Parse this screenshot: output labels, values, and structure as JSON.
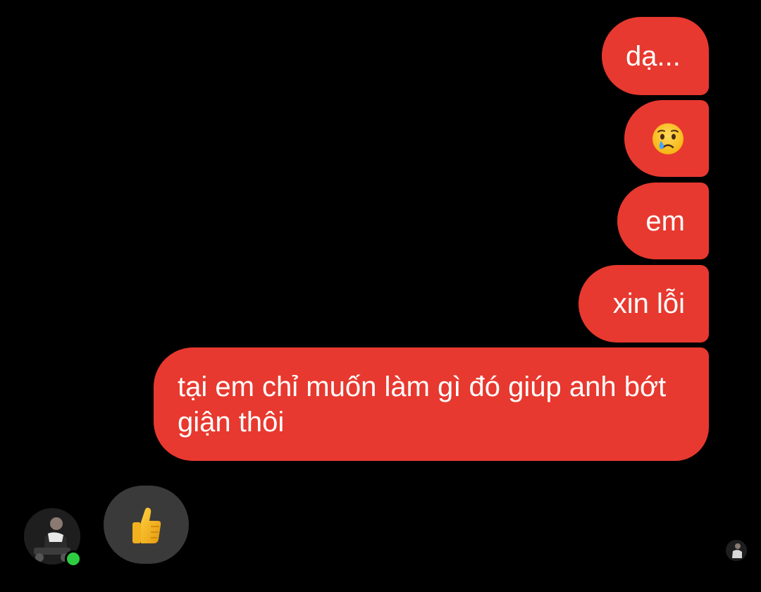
{
  "chat": {
    "messages": [
      {
        "text": "dạ..."
      },
      {
        "emoji": "crying-face"
      },
      {
        "text": "em"
      },
      {
        "text": "xin lỗi"
      },
      {
        "text": "tại em chỉ muốn làm gì đó giúp anh bớt giận thôi"
      }
    ],
    "reaction": {
      "emoji": "thumbs-up"
    },
    "contact": {
      "online": true
    }
  },
  "colors": {
    "bubble_out": "#e7392f",
    "bubble_in": "#3a3a3a",
    "online_dot": "#2ecc40",
    "background": "#000000"
  }
}
